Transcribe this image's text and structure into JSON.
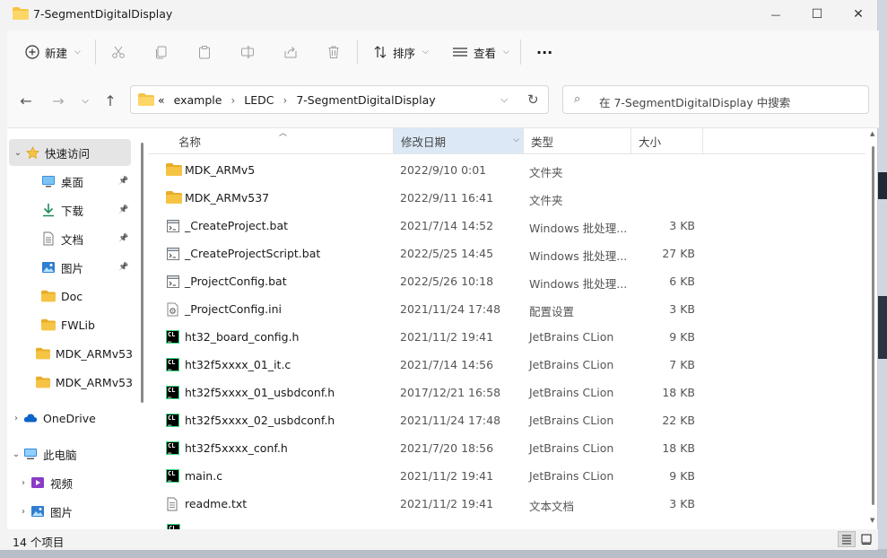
{
  "window": {
    "title": "7-SegmentDigitalDisplay",
    "minimize": "—",
    "maximize": "☐",
    "close": "✕"
  },
  "toolbar": {
    "new_label": "新建",
    "sort_label": "排序",
    "view_label": "查看",
    "more_label": "···"
  },
  "address": {
    "overflow": "«",
    "crumbs": [
      "example",
      "LEDC",
      "7-SegmentDigitalDisplay"
    ]
  },
  "search": {
    "placeholder": "在 7-SegmentDigitalDisplay 中搜索"
  },
  "sidebar": {
    "items": [
      {
        "label": "快速访问",
        "icon": "star-icon"
      },
      {
        "label": "桌面",
        "icon": "desktop-icon",
        "pinned": true
      },
      {
        "label": "下载",
        "icon": "download-icon",
        "pinned": true
      },
      {
        "label": "文档",
        "icon": "document-icon",
        "pinned": true
      },
      {
        "label": "图片",
        "icon": "pictures-icon",
        "pinned": true
      },
      {
        "label": "Doc",
        "icon": "folder-icon"
      },
      {
        "label": "FWLib",
        "icon": "folder-icon"
      },
      {
        "label": "MDK_ARMv53",
        "icon": "folder-icon"
      },
      {
        "label": "MDK_ARMv53",
        "icon": "folder-icon"
      },
      {
        "label": "OneDrive",
        "icon": "cloud-icon"
      },
      {
        "label": "此电脑",
        "icon": "computer-icon"
      },
      {
        "label": "视频",
        "icon": "video-icon"
      },
      {
        "label": "图片",
        "icon": "pictures-icon"
      }
    ]
  },
  "columns": {
    "name": "名称",
    "date": "修改日期",
    "type": "类型",
    "size": "大小"
  },
  "files": [
    {
      "name": "MDK_ARMv5",
      "date": "2022/9/10 0:01",
      "type": "文件夹",
      "size": "",
      "icon": "folder-icon"
    },
    {
      "name": "MDK_ARMv537",
      "date": "2022/9/11 16:41",
      "type": "文件夹",
      "size": "",
      "icon": "folder-icon"
    },
    {
      "name": "_CreateProject.bat",
      "date": "2021/7/14 14:52",
      "type": "Windows 批处理...",
      "size": "3 KB",
      "icon": "batch-file-icon"
    },
    {
      "name": "_CreateProjectScript.bat",
      "date": "2022/5/25 14:45",
      "type": "Windows 批处理...",
      "size": "27 KB",
      "icon": "batch-file-icon"
    },
    {
      "name": "_ProjectConfig.bat",
      "date": "2022/5/26 10:18",
      "type": "Windows 批处理...",
      "size": "6 KB",
      "icon": "batch-file-icon"
    },
    {
      "name": "_ProjectConfig.ini",
      "date": "2021/11/24 17:48",
      "type": "配置设置",
      "size": "3 KB",
      "icon": "config-file-icon"
    },
    {
      "name": "ht32_board_config.h",
      "date": "2021/11/2 19:41",
      "type": "JetBrains CLion",
      "size": "9 KB",
      "icon": "clion-icon"
    },
    {
      "name": "ht32f5xxxx_01_it.c",
      "date": "2021/7/14 14:56",
      "type": "JetBrains CLion",
      "size": "7 KB",
      "icon": "clion-icon"
    },
    {
      "name": "ht32f5xxxx_01_usbdconf.h",
      "date": "2017/12/21 16:58",
      "type": "JetBrains CLion",
      "size": "18 KB",
      "icon": "clion-icon"
    },
    {
      "name": "ht32f5xxxx_02_usbdconf.h",
      "date": "2021/11/24 17:48",
      "type": "JetBrains CLion",
      "size": "22 KB",
      "icon": "clion-icon"
    },
    {
      "name": "ht32f5xxxx_conf.h",
      "date": "2021/7/20 18:56",
      "type": "JetBrains CLion",
      "size": "18 KB",
      "icon": "clion-icon"
    },
    {
      "name": "main.c",
      "date": "2021/11/2 19:41",
      "type": "JetBrains CLion",
      "size": "9 KB",
      "icon": "clion-icon"
    },
    {
      "name": "readme.txt",
      "date": "2021/11/2 19:41",
      "type": "文本文档",
      "size": "3 KB",
      "icon": "text-file-icon"
    }
  ],
  "status": {
    "count": "14 个项目"
  },
  "colors": {
    "folder": "#f6c445",
    "accent": "#0067c0",
    "sorted_header": "#dce8f5"
  }
}
